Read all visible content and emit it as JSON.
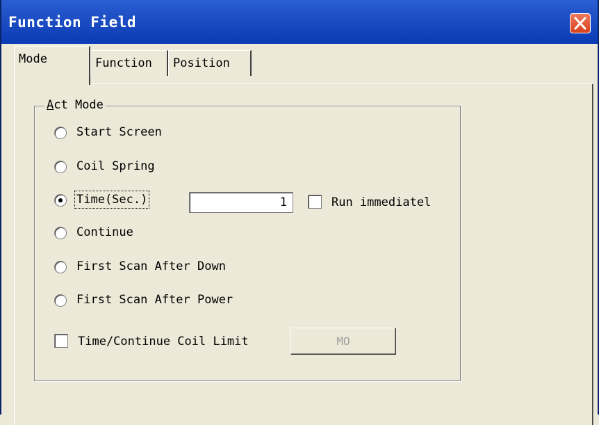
{
  "window": {
    "title": "Function Field"
  },
  "tabs": [
    {
      "label": "Mode",
      "active": true
    },
    {
      "label": "Function",
      "active": false
    },
    {
      "label": "Position",
      "active": false
    }
  ],
  "act_mode": {
    "group_label": "Act Mode",
    "options": [
      {
        "label": "Start Screen",
        "selected": false
      },
      {
        "label": "Coil Spring",
        "selected": false
      },
      {
        "label": "Time(Sec.)",
        "selected": true
      },
      {
        "label": "Continue",
        "selected": false
      },
      {
        "label": "First Scan After Down",
        "selected": false
      },
      {
        "label": "First Scan After Power",
        "selected": false
      }
    ],
    "time_value": "1",
    "run_immediately": {
      "label": "Run immediatel",
      "checked": false
    },
    "coil_limit": {
      "label": "Time/Continue Coil Limit",
      "checked": false
    },
    "coil_limit_button": "MO"
  },
  "colors": {
    "titlebar": "#0a3bb5",
    "close_button": "#d8401e",
    "face": "#ece9d8"
  },
  "icons": {
    "close": "close-x-icon"
  }
}
